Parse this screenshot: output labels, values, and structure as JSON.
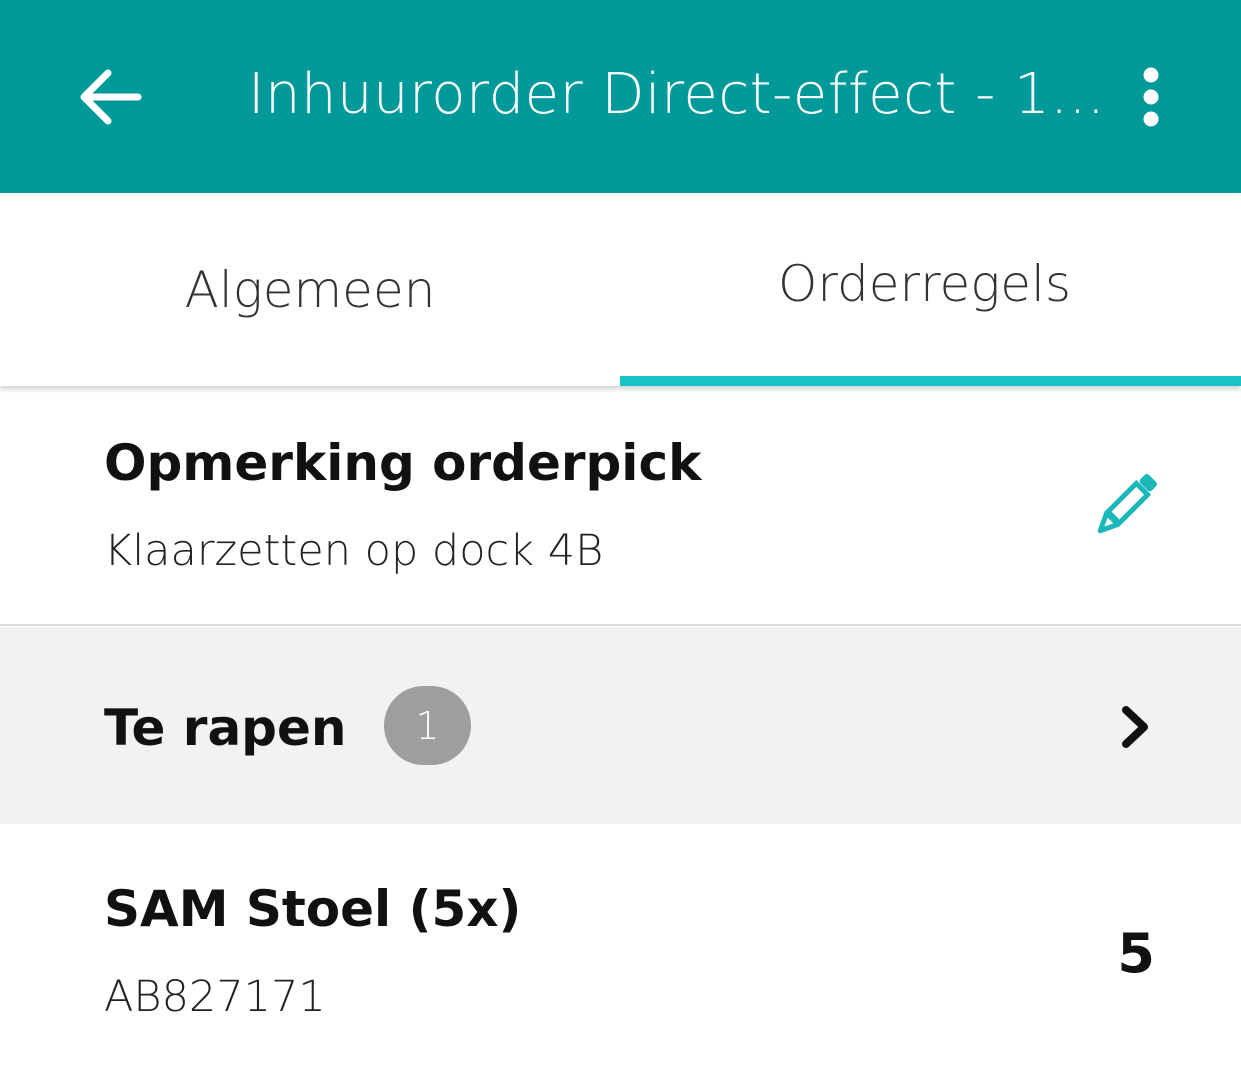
{
  "appbar": {
    "title": "Inhuurorder Direct-effect - 1...",
    "back_icon": "arrow-left-icon",
    "more_icon": "more-vertical-icon",
    "background": "#00999a"
  },
  "tabs": [
    {
      "label": "Algemeen",
      "selected": false
    },
    {
      "label": "Orderregels",
      "selected": true
    }
  ],
  "tab_indicator_color": "#1ac3c3",
  "remark": {
    "title": "Opmerking orderpick",
    "text": "Klaarzetten op dock 4B",
    "edit_icon": "pencil-icon",
    "edit_icon_color": "#1ab8b8"
  },
  "section": {
    "title": "Te rapen",
    "count": "1",
    "chevron_icon": "chevron-right-icon"
  },
  "items": [
    {
      "name": "SAM Stoel (5x)",
      "code": "AB827171",
      "quantity": "5"
    }
  ]
}
